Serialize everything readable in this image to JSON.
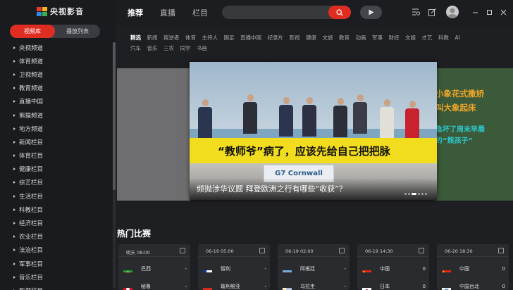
{
  "app": {
    "title": "央视影音"
  },
  "sidebar": {
    "tabs": [
      {
        "label": "视频库"
      },
      {
        "label": "播放列表"
      }
    ],
    "channels": [
      {
        "label": "央视频道"
      },
      {
        "label": "体育频道"
      },
      {
        "label": "卫视频道"
      },
      {
        "label": "教育频道"
      },
      {
        "label": "直播中国"
      },
      {
        "label": "熊猫频道"
      },
      {
        "label": "地方频道"
      },
      {
        "label": "新闻栏目"
      },
      {
        "label": "体育栏目"
      },
      {
        "label": "健康栏目"
      },
      {
        "label": "综艺栏目"
      },
      {
        "label": "生活栏目"
      },
      {
        "label": "科教栏目"
      },
      {
        "label": "经济栏目"
      },
      {
        "label": "农业栏目"
      },
      {
        "label": "法治栏目"
      },
      {
        "label": "军事栏目"
      },
      {
        "label": "音乐栏目"
      },
      {
        "label": "影视栏目"
      }
    ]
  },
  "topnav": {
    "items": [
      {
        "label": "推荐"
      },
      {
        "label": "直播"
      },
      {
        "label": "栏目"
      }
    ],
    "search": {
      "placeholder": ""
    }
  },
  "categories": {
    "row1": [
      "精选",
      "新闻",
      "叛逆者",
      "体育",
      "主持人",
      "国足",
      "直播中国",
      "纪录片",
      "影视",
      "健康",
      "文旅",
      "教育",
      "动画",
      "军事",
      "财经",
      "文娱",
      "才艺",
      "科教",
      "AI"
    ],
    "row2": [
      "汽车",
      "音乐",
      "三农",
      "同学",
      "书画"
    ]
  },
  "carousel": {
    "main": {
      "banner_text": "“教师爷”病了，应该先给自己把把脉",
      "sign_text": "G7 Cornwall",
      "caption": "频抛涉华议题 拜登欧洲之行有哪些“收获”？"
    },
    "right": {
      "line1": "小象花式撒娇",
      "line2": "叫大象起床",
      "line3": "急坏了周末早晨",
      "line4": "的“熊孩子”"
    }
  },
  "hot_matches": {
    "title": "热门比赛",
    "matches": [
      {
        "time": "明天 08:00",
        "team1": {
          "name": "巴西",
          "score": "-",
          "flag": "brazil"
        },
        "team2": {
          "name": "秘鲁",
          "score": "-",
          "flag": "peru"
        }
      },
      {
        "time": "06-19 05:00",
        "team1": {
          "name": "智利",
          "score": "-",
          "flag": "chile"
        },
        "team2": {
          "name": "玻利维亚",
          "score": "-",
          "flag": "bolivia"
        }
      },
      {
        "time": "06-19 02:00",
        "team1": {
          "name": "阿根廷",
          "score": "-",
          "flag": "argentina"
        },
        "team2": {
          "name": "乌拉圭",
          "score": "-",
          "flag": "uruguay"
        }
      },
      {
        "time": "06-19 14:30",
        "team1": {
          "name": "中国",
          "score": "0",
          "flag": "china"
        },
        "team2": {
          "name": "日本",
          "score": "0",
          "flag": "japan"
        }
      },
      {
        "time": "06-20 18:30",
        "team1": {
          "name": "中国",
          "score": "0",
          "flag": "china"
        },
        "team2": {
          "name": "中国台北",
          "score": "0",
          "flag": "chinese-taipei"
        }
      }
    ]
  },
  "colors": {
    "accent": "#e02d22",
    "background": "#1e1f23",
    "sidebar": "#1a1b1e",
    "card": "#2a2b2f"
  }
}
